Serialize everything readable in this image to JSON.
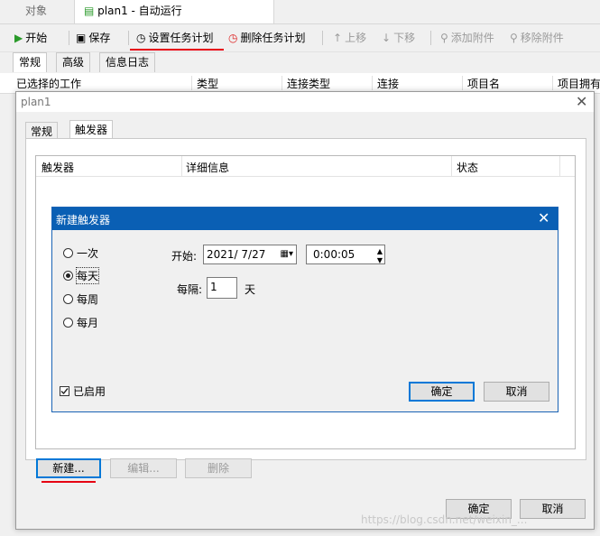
{
  "top_tabs": {
    "objects": "对象",
    "plan": "plan1 - 自动运行"
  },
  "toolbar": {
    "start": "开始",
    "save": "保存",
    "set_schedule": "设置任务计划",
    "delete_schedule": "删除任务计划",
    "move_up": "上移",
    "move_down": "下移",
    "add_attachment": "添加附件",
    "remove_attachment": "移除附件"
  },
  "sub_tabs": [
    "常规",
    "高级",
    "信息日志"
  ],
  "background_table": {
    "columns": [
      "已选择的工作",
      "类型",
      "连接类型",
      "连接",
      "项目名",
      "项目拥有"
    ]
  },
  "plan_dialog": {
    "title": "plan1",
    "tabs": [
      "常规",
      "触发器"
    ],
    "list_columns": [
      "触发器",
      "详细信息",
      "状态"
    ],
    "buttons": {
      "new": "新建...",
      "edit": "编辑...",
      "delete": "删除"
    },
    "ok": "确定",
    "cancel": "取消"
  },
  "trigger_dialog": {
    "title": "新建触发器",
    "options": [
      "一次",
      "每天",
      "每周",
      "每月"
    ],
    "selected": "每天",
    "start_label": "开始:",
    "start_date": "2021/  7/27",
    "start_time": "0:00:05",
    "interval_label": "每隔:",
    "interval_value": "1",
    "interval_unit": "天",
    "enabled_label": "已启用",
    "enabled": true,
    "ok": "确定",
    "cancel": "取消"
  },
  "watermark": "https://blog.csdn.net/weixin_...",
  "colors": {
    "title_blue": "#0a5fb4",
    "highlight_red": "#e60012",
    "focus_blue": "#0078d7"
  }
}
